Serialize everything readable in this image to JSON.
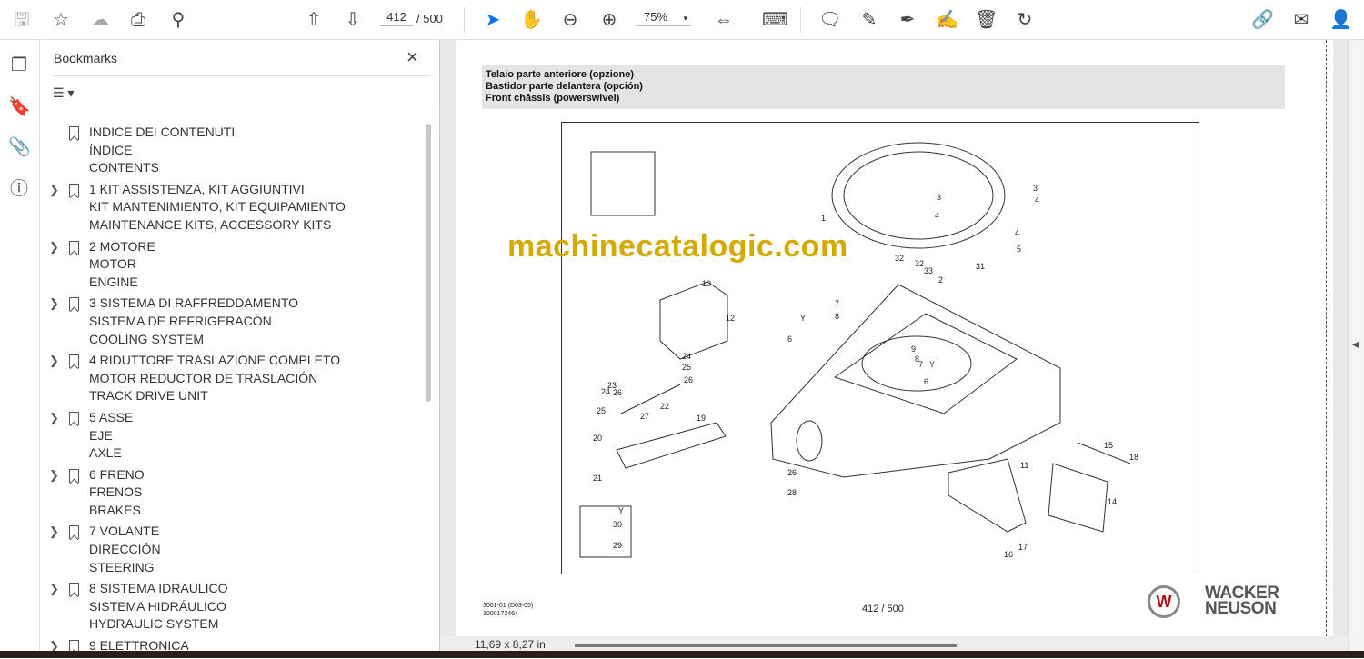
{
  "toolbar": {
    "page_current": "412",
    "page_total": "/ 500",
    "zoom": "75%"
  },
  "bookmarks": {
    "title": "Bookmarks",
    "items": [
      {
        "lines": [
          "INDICE DEI CONTENUTI",
          "ÍNDICE",
          "CONTENTS"
        ],
        "expandable": false
      },
      {
        "lines": [
          "1 KIT ASSISTENZA, KIT AGGIUNTIVI",
          "KIT MANTENIMIENTO, KIT EQUIPAMIENTO",
          "MAINTENANCE KITS, ACCESSORY KITS"
        ],
        "expandable": true
      },
      {
        "lines": [
          "2 MOTORE",
          "MOTOR",
          "ENGINE"
        ],
        "expandable": true
      },
      {
        "lines": [
          "3 SISTEMA DI RAFFREDDAMENTO",
          "SISTEMA DE REFRIGERACÓN",
          "COOLING SYSTEM"
        ],
        "expandable": true
      },
      {
        "lines": [
          "4 RIDUTTORE TRASLAZIONE COMPLETO",
          "MOTOR REDUCTOR DE TRASLACIÓN",
          "TRACK DRIVE UNIT"
        ],
        "expandable": true
      },
      {
        "lines": [
          "5 ASSE",
          "EJE",
          "AXLE"
        ],
        "expandable": true
      },
      {
        "lines": [
          "6 FRENO",
          "FRENOS",
          "BRAKES"
        ],
        "expandable": true
      },
      {
        "lines": [
          "7 VOLANTE",
          "DIRECCIÓN",
          "STEERING"
        ],
        "expandable": true
      },
      {
        "lines": [
          "8 SISTEMA IDRAULICO",
          "SISTEMA HIDRÁULICO",
          "HYDRAULIC SYSTEM"
        ],
        "expandable": true
      },
      {
        "lines": [
          "9 ELETTRONICA"
        ],
        "expandable": true
      }
    ]
  },
  "document": {
    "header": [
      "Telaio parte anteriore (opzione)",
      "Bastidor parte delantera (opción)",
      "Front châssis (powerswivel)"
    ],
    "watermark": "machinecatalogic.com",
    "footer_code": "3001-01 (D03-05)",
    "footer_number": "1000173464",
    "page_label": "412 / 500",
    "brand_line1": "WACKER",
    "brand_line2": "NEUSON",
    "callouts": [
      "1",
      "3",
      "4",
      "3",
      "4",
      "4",
      "5",
      "2",
      "31",
      "32",
      "32",
      "33",
      "10",
      "12",
      "7",
      "8",
      "6",
      "Y",
      "9",
      "8",
      "7",
      "Y",
      "6",
      "24",
      "25",
      "26",
      "22",
      "23",
      "24",
      "26",
      "25",
      "27",
      "19",
      "20",
      "21",
      "26",
      "28",
      "11",
      "15",
      "18",
      "14",
      "17",
      "16",
      "Y",
      "30",
      "29"
    ]
  },
  "status": {
    "page_size": "11,69 x 8,27 in"
  },
  "colors": {
    "accent": "#1473e6",
    "watermark": "#d4a900"
  }
}
